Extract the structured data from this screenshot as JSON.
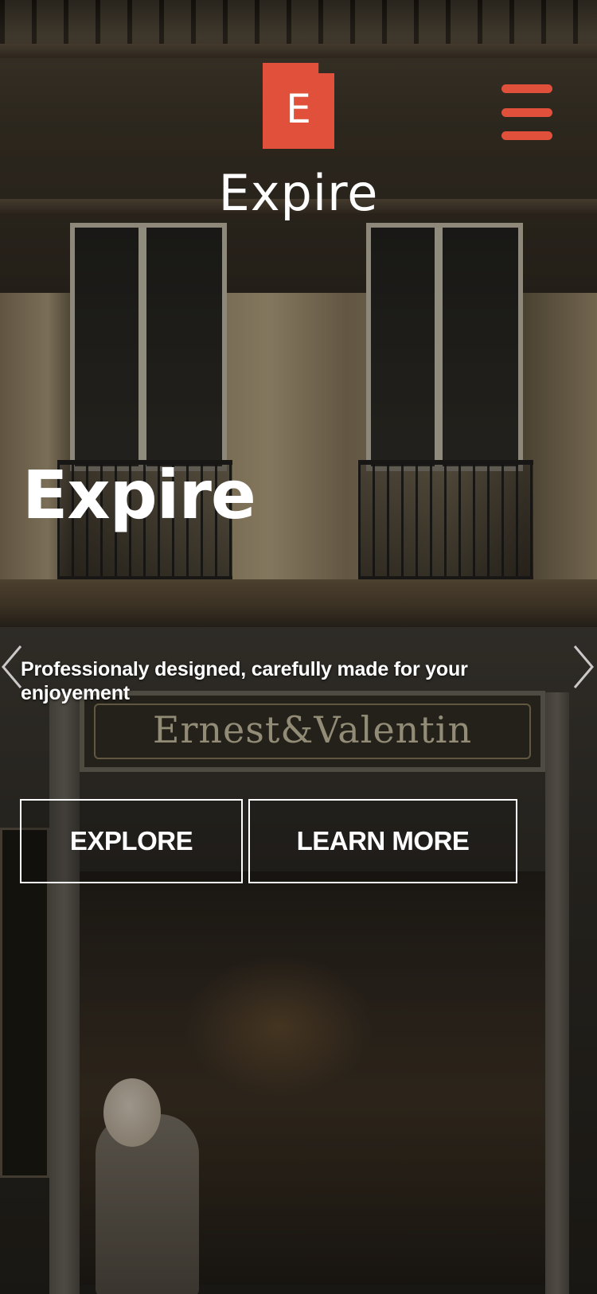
{
  "header": {
    "logo_letter": "E",
    "logo_text": "Expire",
    "menu_icon": "hamburger-menu-icon"
  },
  "hero": {
    "title": "Expire",
    "subtitle": "Professionaly designed, carefully made for your enjoyement",
    "prev_icon": "chevron-left-icon",
    "next_icon": "chevron-right-icon",
    "buttons": {
      "explore_label": "EXPLORE",
      "learn_more_label": "LEARN MORE"
    },
    "background_sign_text": "Ernest&Valentin"
  },
  "colors": {
    "accent": "#e0503b",
    "text": "#ffffff"
  }
}
